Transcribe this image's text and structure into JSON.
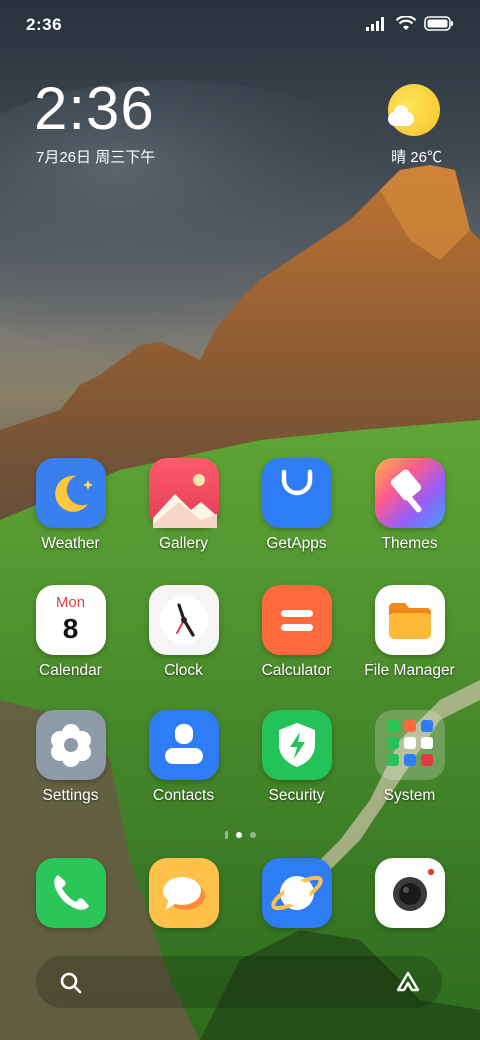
{
  "status_bar": {
    "time": "2:36",
    "icons": [
      "signal-icon",
      "wifi-icon",
      "battery-icon"
    ]
  },
  "clock_widget": {
    "time": "2:36",
    "date": "7月26日 周三下午"
  },
  "weather_widget": {
    "condition_icon": "sun-cloud-icon",
    "text": "晴 26℃"
  },
  "apps": [
    {
      "label": "Weather",
      "icon": "weather-icon"
    },
    {
      "label": "Gallery",
      "icon": "gallery-icon"
    },
    {
      "label": "GetApps",
      "icon": "getapps-icon"
    },
    {
      "label": "Themes",
      "icon": "themes-icon"
    },
    {
      "label": "Calendar",
      "icon": "calendar-icon",
      "month": "Mon",
      "day": "8"
    },
    {
      "label": "Clock",
      "icon": "clock-icon"
    },
    {
      "label": "Calculator",
      "icon": "calculator-icon"
    },
    {
      "label": "File Manager",
      "icon": "file-manager-icon"
    },
    {
      "label": "Settings",
      "icon": "settings-icon"
    },
    {
      "label": "Contacts",
      "icon": "contacts-icon"
    },
    {
      "label": "Security",
      "icon": "security-icon"
    },
    {
      "label": "System",
      "icon": "folder-icon"
    }
  ],
  "page_indicator": {
    "pages": 2,
    "current": 1
  },
  "dock": [
    {
      "name": "phone",
      "icon": "phone-icon"
    },
    {
      "name": "messages",
      "icon": "messages-icon"
    },
    {
      "name": "browser",
      "icon": "browser-icon"
    },
    {
      "name": "camera",
      "icon": "camera-icon"
    }
  ],
  "search_bar": {
    "left_icon": "search-icon",
    "right_icon": "assistant-icon"
  },
  "colors": {
    "weather": "#3a7ff0",
    "gallery": "#ef4d5f",
    "getapps": "#2f7df6",
    "themes": "#8a5cf6",
    "calculator": "#ff6a3d",
    "settings": "#8f9aa8",
    "contacts": "#2f7df6",
    "security": "#23c35a",
    "phone": "#2bc65a",
    "messages": "#ffc14a",
    "browser": "#2f7df6"
  }
}
